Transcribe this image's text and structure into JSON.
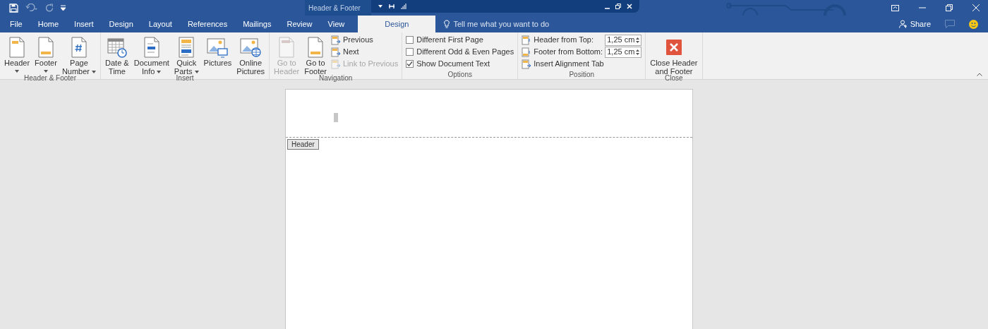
{
  "title_bar": {
    "contextual_title": "Header & Footer"
  },
  "tabs": [
    {
      "label": "File",
      "selected": false,
      "contextual": false
    },
    {
      "label": "Home",
      "selected": false,
      "contextual": false
    },
    {
      "label": "Insert",
      "selected": false,
      "contextual": false
    },
    {
      "label": "Design",
      "selected": false,
      "contextual": false
    },
    {
      "label": "Layout",
      "selected": false,
      "contextual": false
    },
    {
      "label": "References",
      "selected": false,
      "contextual": false
    },
    {
      "label": "Mailings",
      "selected": false,
      "contextual": false
    },
    {
      "label": "Review",
      "selected": false,
      "contextual": false
    },
    {
      "label": "View",
      "selected": false,
      "contextual": false
    },
    {
      "label": "Design",
      "selected": true,
      "contextual": true
    }
  ],
  "tell_me": {
    "placeholder": "Tell me what you want to do"
  },
  "share": "Share",
  "ribbon": {
    "groups": [
      {
        "label": "Header & Footer",
        "items": [
          {
            "kind": "large",
            "lines": [
              "Header"
            ],
            "dropdown": true,
            "disabled": false
          },
          {
            "kind": "large",
            "lines": [
              "Footer"
            ],
            "dropdown": true,
            "disabled": false
          },
          {
            "kind": "large",
            "lines": [
              "Page",
              "Number"
            ],
            "dropdown": true,
            "disabled": false
          }
        ]
      },
      {
        "label": "Insert",
        "items": [
          {
            "kind": "large",
            "lines": [
              "Date &",
              "Time"
            ],
            "dropdown": false,
            "disabled": false
          },
          {
            "kind": "large",
            "lines": [
              "Document",
              "Info"
            ],
            "dropdown": true,
            "disabled": false
          },
          {
            "kind": "large",
            "lines": [
              "Quick",
              "Parts"
            ],
            "dropdown": true,
            "disabled": false
          },
          {
            "kind": "large",
            "lines": [
              "Pictures"
            ],
            "dropdown": false,
            "disabled": false
          },
          {
            "kind": "large",
            "lines": [
              "Online",
              "Pictures"
            ],
            "dropdown": false,
            "disabled": false
          }
        ]
      },
      {
        "label": "Navigation",
        "items": [
          {
            "kind": "large",
            "lines": [
              "Go to",
              "Header"
            ],
            "dropdown": false,
            "disabled": true
          },
          {
            "kind": "large",
            "lines": [
              "Go to",
              "Footer"
            ],
            "dropdown": false,
            "disabled": false
          },
          {
            "kind": "stack",
            "items": [
              {
                "kind": "small",
                "label": "Previous",
                "disabled": false
              },
              {
                "kind": "small",
                "label": "Next",
                "disabled": false
              },
              {
                "kind": "small",
                "label": "Link to Previous",
                "disabled": true
              }
            ]
          }
        ]
      },
      {
        "label": "Options",
        "items": [
          {
            "kind": "stack",
            "items": [
              {
                "kind": "checkbox",
                "label": "Different First Page",
                "checked": false
              },
              {
                "kind": "checkbox",
                "label": "Different Odd & Even Pages",
                "checked": false
              },
              {
                "kind": "checkbox",
                "label": "Show Document Text",
                "checked": true
              }
            ]
          }
        ]
      },
      {
        "label": "Position",
        "items": [
          {
            "kind": "stack",
            "items": [
              {
                "kind": "spinner",
                "label": "Header from Top:",
                "value": "1,25 cm"
              },
              {
                "kind": "spinner",
                "label": "Footer from Bottom:",
                "value": "1,25 cm"
              },
              {
                "kind": "small",
                "label": "Insert Alignment Tab",
                "disabled": false
              }
            ]
          }
        ]
      },
      {
        "label": "Close",
        "items": [
          {
            "kind": "large",
            "lines": [
              "Close Header",
              "and Footer"
            ],
            "dropdown": false,
            "disabled": false
          }
        ]
      }
    ]
  },
  "document": {
    "header_tag": "Header"
  }
}
